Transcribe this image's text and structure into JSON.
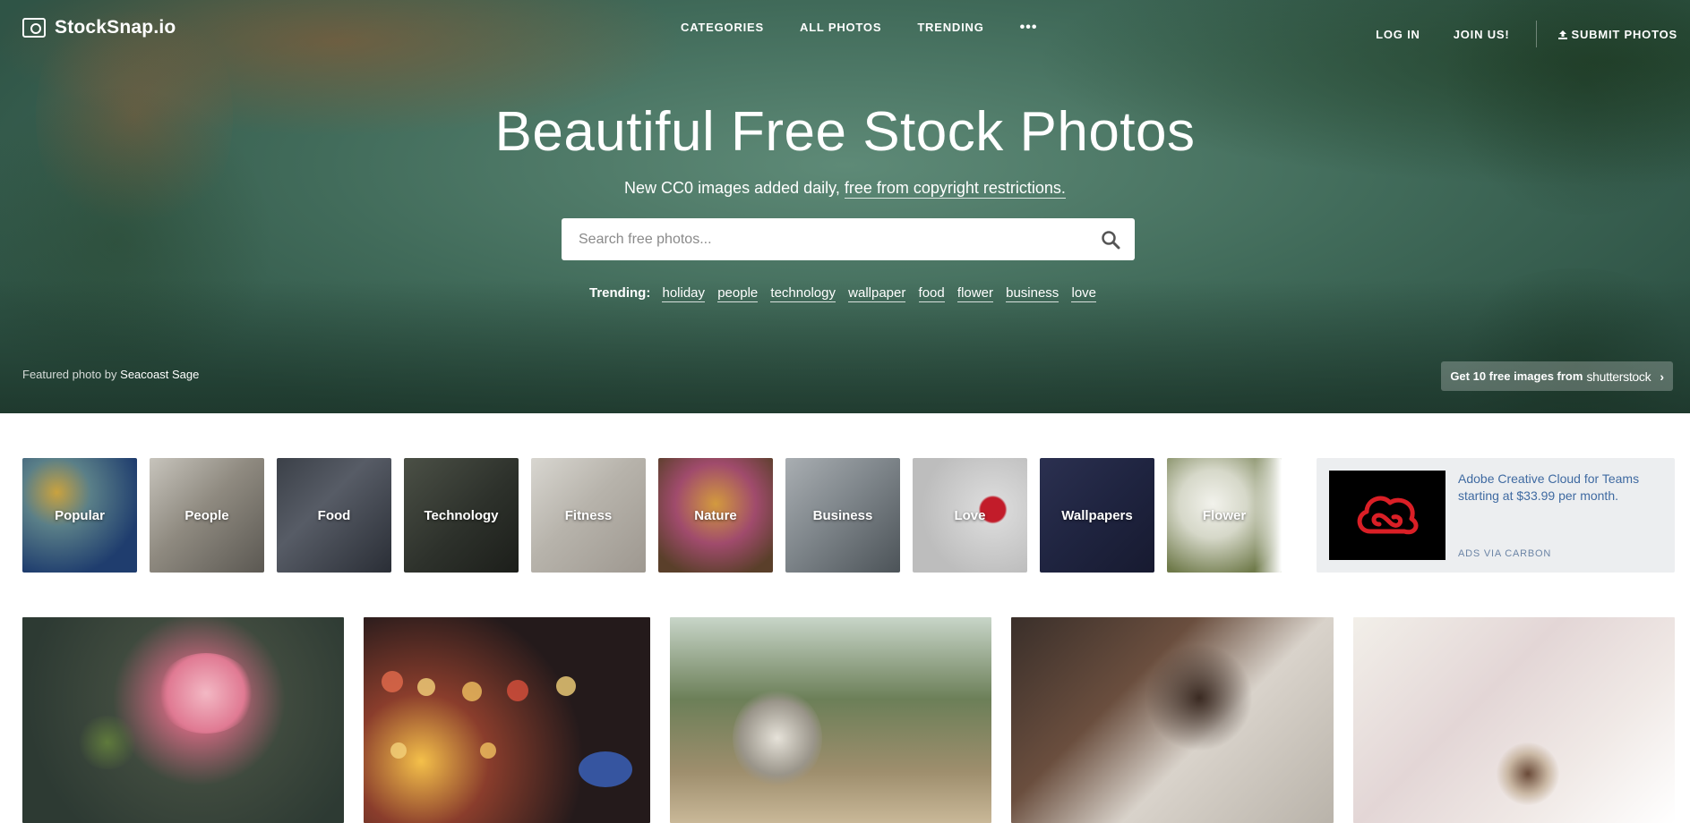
{
  "nav": {
    "logo_text": "StockSnap.io",
    "center": [
      "CATEGORIES",
      "ALL PHOTOS",
      "TRENDING"
    ],
    "more": "•••",
    "login": "LOG IN",
    "join": "JOIN US!",
    "submit": "SUBMIT PHOTOS"
  },
  "hero": {
    "title": "Beautiful Free Stock Photos",
    "subtitle_prefix": "New CC0 images added daily,",
    "subtitle_link": "free from copyright restrictions.",
    "search_placeholder": "Search free photos...",
    "trending_label": "Trending:",
    "trending_tags": [
      "holiday",
      "people",
      "technology",
      "wallpaper",
      "food",
      "flower",
      "business",
      "love"
    ],
    "credit_prefix": "Featured photo by",
    "credit_author": "Seacoast Sage",
    "promo_text": "Get 10 free images from",
    "promo_brand": "shutterstock"
  },
  "categories": [
    "Popular",
    "People",
    "Food",
    "Technology",
    "Fitness",
    "Nature",
    "Business",
    "Love",
    "Wallpapers",
    "Flower"
  ],
  "ad": {
    "text": "Adobe Creative Cloud for Teams starting at $33.99 per month.",
    "via": "ADS VIA CARBON"
  },
  "colors": {
    "ad_text": "#3f6aa1",
    "adobe_red": "#da1f26"
  }
}
